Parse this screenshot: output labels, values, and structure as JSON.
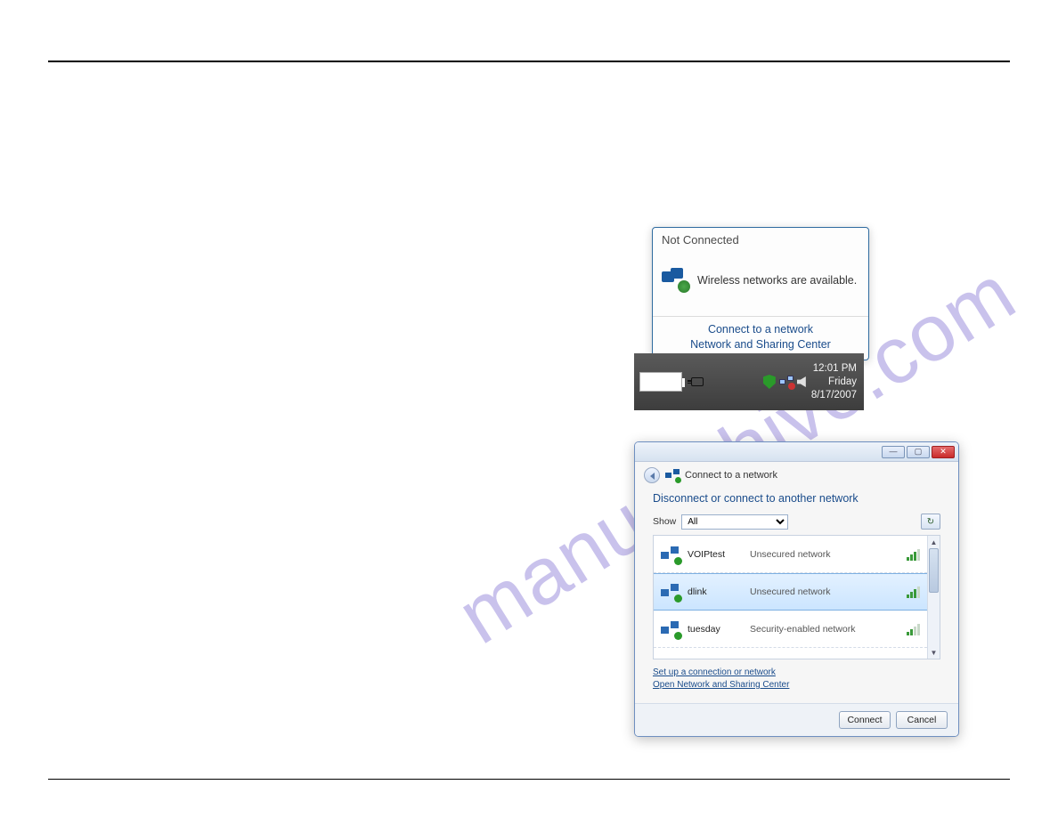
{
  "watermark": "manualshive.com",
  "popup": {
    "status": "Not Connected",
    "message": "Wireless networks are available.",
    "link_connect": "Connect to a network",
    "link_sharing": "Network and Sharing Center"
  },
  "taskbar": {
    "time": "12:01 PM",
    "day": "Friday",
    "date": "8/17/2007"
  },
  "wizard": {
    "title": "Connect to a network",
    "heading": "Disconnect or connect to another network",
    "show_label": "Show",
    "show_value": "All",
    "networks": [
      {
        "name": "VOIPtest",
        "security": "Unsecured network",
        "signal": "mid",
        "selected": false
      },
      {
        "name": "dlink",
        "security": "Unsecured network",
        "signal": "mid",
        "selected": true
      },
      {
        "name": "tuesday",
        "security": "Security-enabled network",
        "signal": "weak",
        "selected": false
      }
    ],
    "link_setup": "Set up a connection or network",
    "link_open_center": "Open Network and Sharing Center",
    "btn_connect": "Connect",
    "btn_cancel": "Cancel"
  }
}
